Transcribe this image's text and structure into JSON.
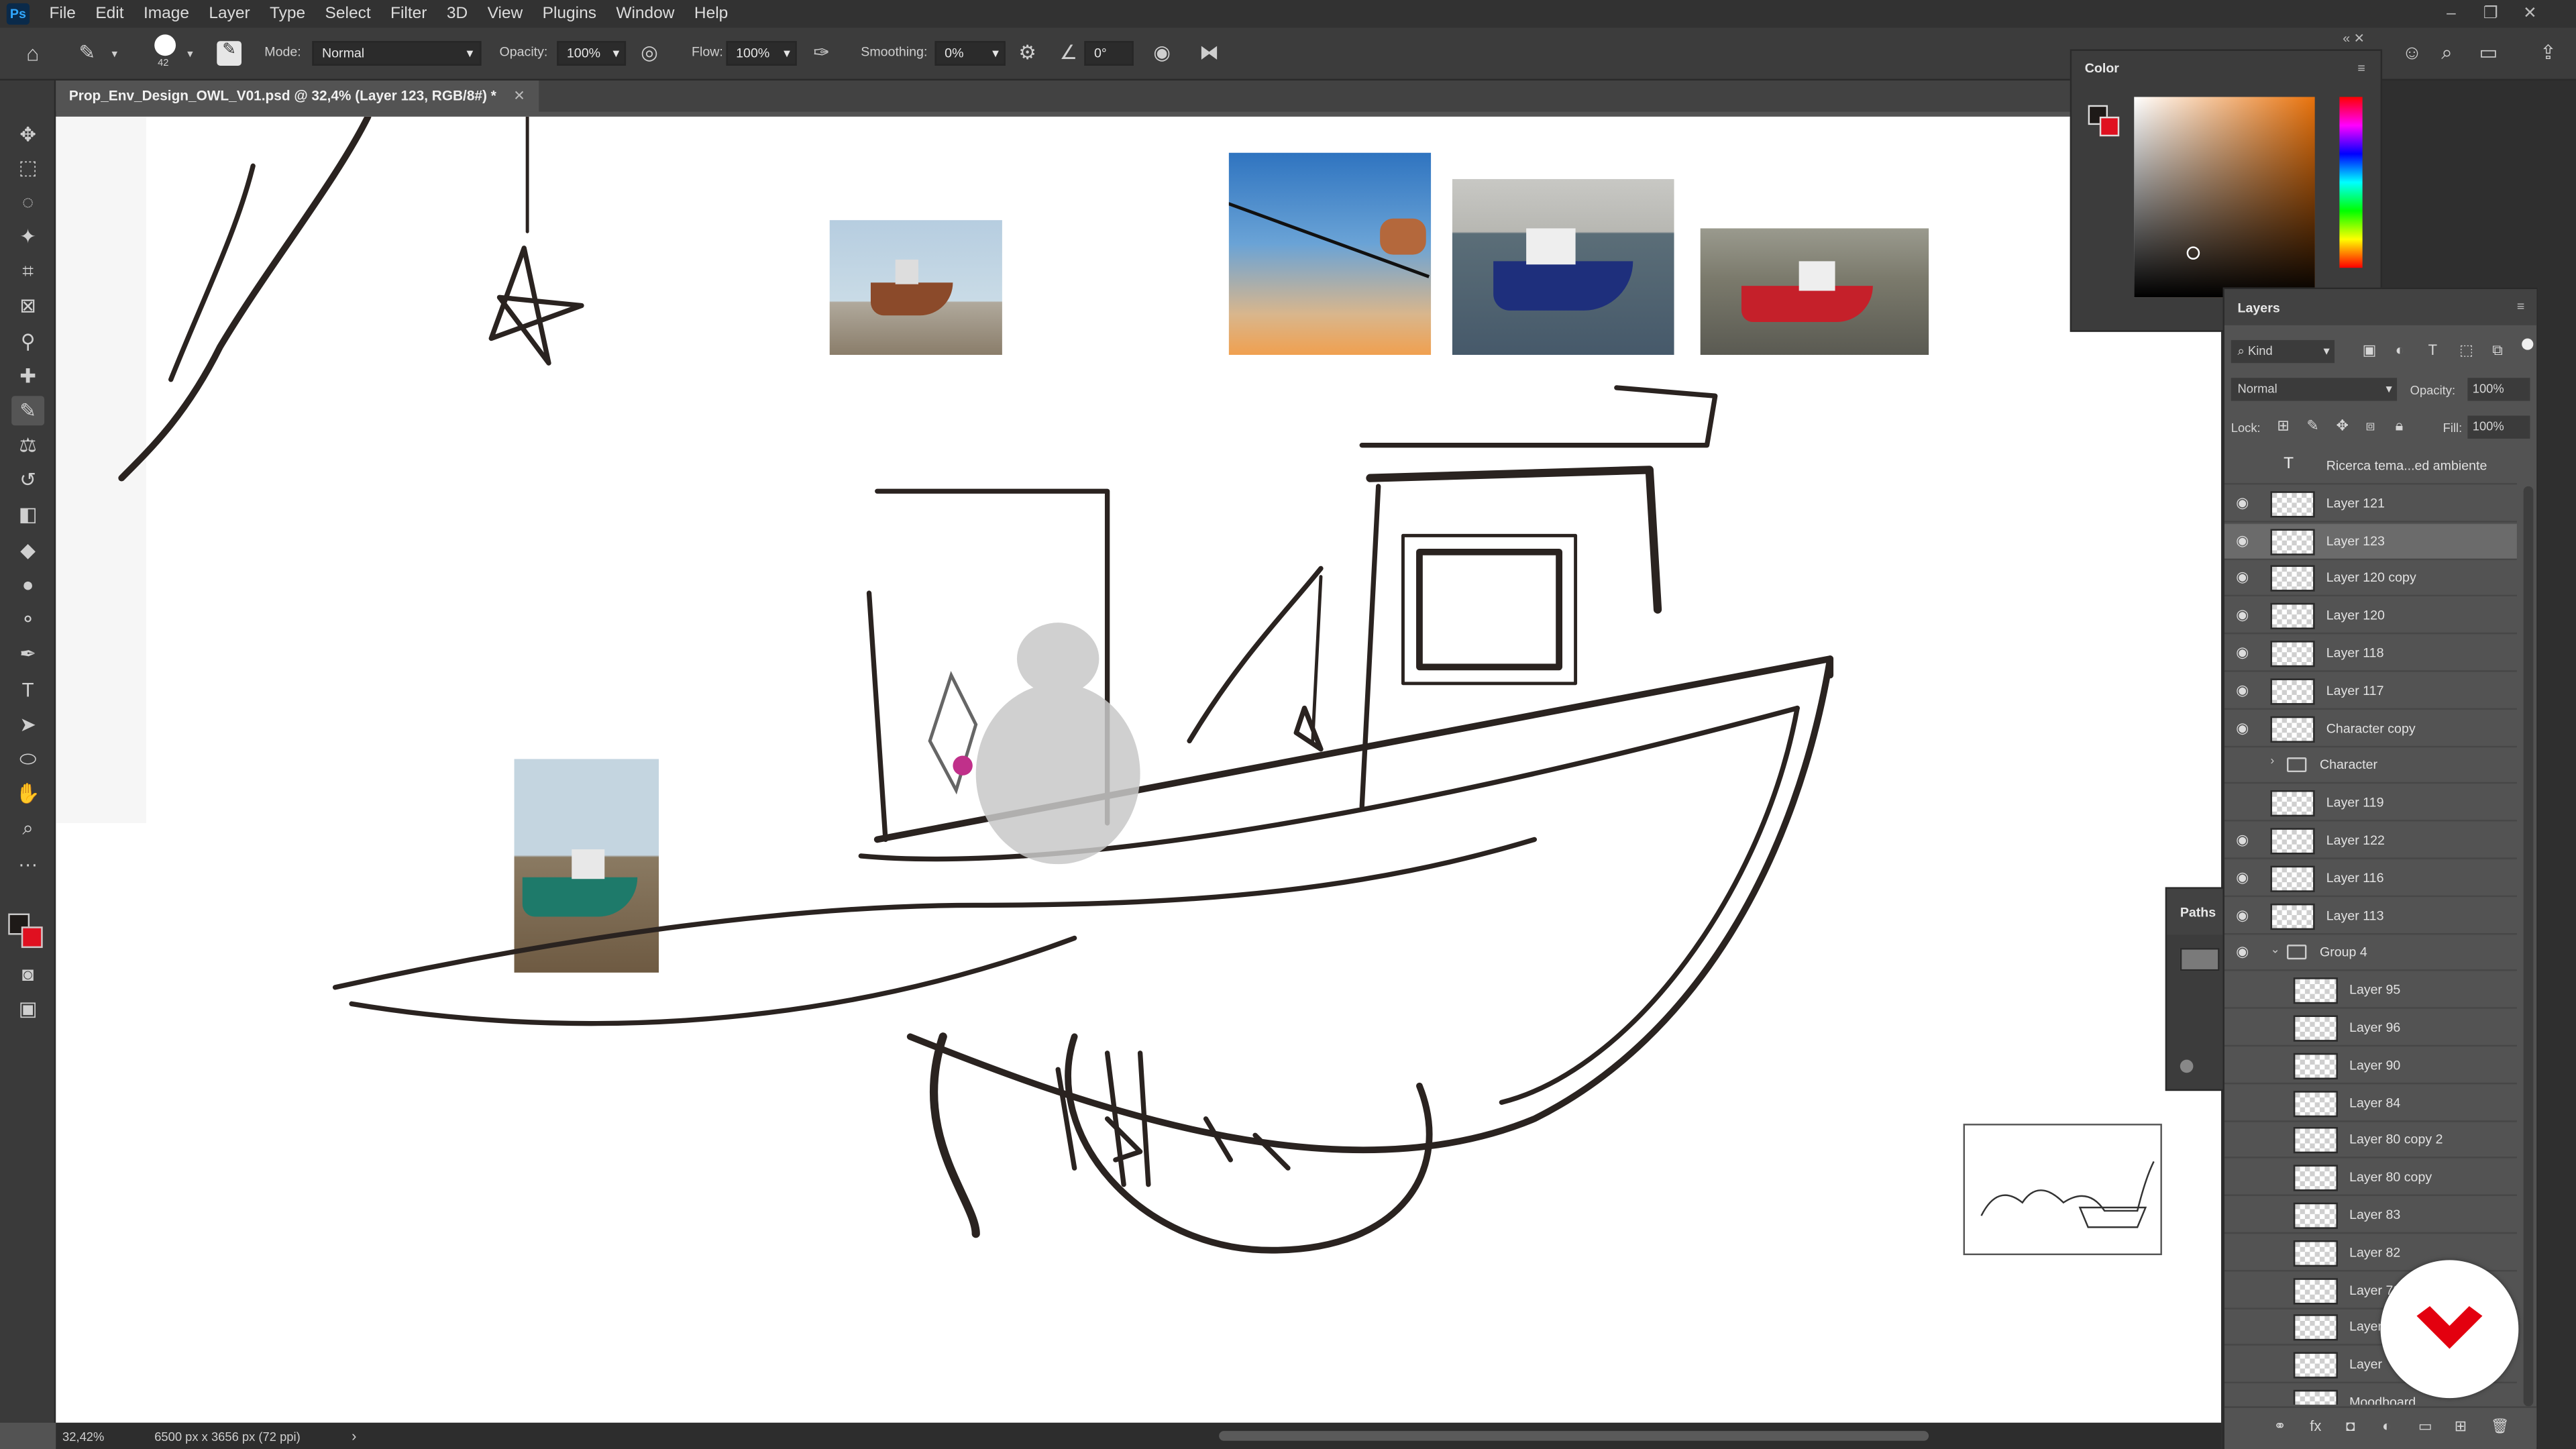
{
  "app": {
    "logo": "Ps"
  },
  "menu": [
    "File",
    "Edit",
    "Image",
    "Layer",
    "Type",
    "Select",
    "Filter",
    "3D",
    "View",
    "Plugins",
    "Window",
    "Help"
  ],
  "options": {
    "brush_size": "42",
    "mode_label": "Mode:",
    "mode_value": "Normal",
    "opacity_label": "Opacity:",
    "opacity_value": "100%",
    "flow_label": "Flow:",
    "flow_value": "100%",
    "smoothing_label": "Smoothing:",
    "smoothing_value": "0%",
    "angle_value": "0°"
  },
  "document": {
    "tab_title": "Prop_Env_Design_OWL_V01.psd @ 32,4% (Layer 123, RGB/8#) *"
  },
  "status": {
    "zoom": "32,42%",
    "doc_size": "6500 px x 3656 px (72 ppi)"
  },
  "color_panel": {
    "title": "Color",
    "fg_color": "#1e1a18",
    "bg_color": "#e01020"
  },
  "paths_panel": {
    "title": "Paths"
  },
  "layers_panel": {
    "title": "Layers",
    "filter_kind": "Kind",
    "blend_mode": "Normal",
    "opacity_label": "Opacity:",
    "opacity_value": "100%",
    "lock_label": "Lock:",
    "fill_label": "Fill:",
    "fill_value": "100%",
    "layers": [
      {
        "name": "Ricerca tema...ed ambiente",
        "visible": false,
        "type": "text"
      },
      {
        "name": "Layer 121",
        "visible": true
      },
      {
        "name": "Layer 123",
        "visible": true,
        "selected": true
      },
      {
        "name": "Layer 120 copy",
        "visible": true
      },
      {
        "name": "Layer 120",
        "visible": true
      },
      {
        "name": "Layer 118",
        "visible": true
      },
      {
        "name": "Layer 117",
        "visible": true
      },
      {
        "name": "Character copy",
        "visible": true
      },
      {
        "name": "Character",
        "visible": false,
        "type": "group"
      },
      {
        "name": "Layer 119",
        "visible": false
      },
      {
        "name": "Layer 122",
        "visible": true
      },
      {
        "name": "Layer 116",
        "visible": true
      },
      {
        "name": "Layer 113",
        "visible": true
      },
      {
        "name": "Group 4",
        "visible": true,
        "type": "group-open"
      },
      {
        "name": "Layer 95",
        "visible": false,
        "indent": true
      },
      {
        "name": "Layer 96",
        "visible": false,
        "indent": true
      },
      {
        "name": "Layer 90",
        "visible": false,
        "indent": true
      },
      {
        "name": "Layer 84",
        "visible": false,
        "indent": true
      },
      {
        "name": "Layer 80 copy 2",
        "visible": false,
        "indent": true
      },
      {
        "name": "Layer 80 copy",
        "visible": false,
        "indent": true
      },
      {
        "name": "Layer 83",
        "visible": false,
        "indent": true
      },
      {
        "name": "Layer 82",
        "visible": false,
        "indent": true
      },
      {
        "name": "Layer 79",
        "visible": false,
        "indent": true
      },
      {
        "name": "Layer",
        "visible": false,
        "indent": true
      },
      {
        "name": "Layer",
        "visible": false,
        "indent": true
      },
      {
        "name": "Moodboard",
        "visible": false,
        "indent": true
      }
    ]
  },
  "colors": {
    "accent_red": "#e3000f"
  }
}
